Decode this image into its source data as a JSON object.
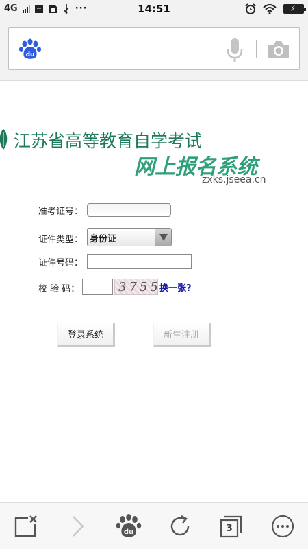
{
  "status_bar": {
    "network": "4G",
    "time": "14:51",
    "more_indicator": "···",
    "icons": [
      "signal-icon",
      "bag-icon",
      "sim-icon",
      "usb-icon",
      "alarm-icon",
      "wifi-icon",
      "battery-icon"
    ]
  },
  "search": {
    "placeholder": "",
    "logo_icon": "baidu-paw-icon",
    "mic_icon": "microphone-icon",
    "camera_icon": "camera-icon"
  },
  "brand": {
    "line1": "江苏省高等教育自学考试",
    "line2": "网上报名系统",
    "url": "zxks.jseea.cn",
    "color_primary": "#1f7a5a",
    "color_secondary": "#2fa07a"
  },
  "form": {
    "exam_id_label": "准考证号：",
    "exam_id_value": "",
    "id_type_label": "证件类型：",
    "id_type_selected": "身份证",
    "id_number_label": "证件号码：",
    "id_number_value": "",
    "captcha_label": "校 验 码：",
    "captcha_value": "",
    "captcha_image_text": "3755",
    "captcha_refresh": "换一张?",
    "login_button": "登录系统",
    "register_button": "新生注册"
  },
  "toolbar": {
    "tab_count": "3",
    "icons": [
      "close-page-icon",
      "forward-icon",
      "baidu-home-icon",
      "refresh-icon",
      "tabs-icon",
      "more-icon"
    ]
  }
}
